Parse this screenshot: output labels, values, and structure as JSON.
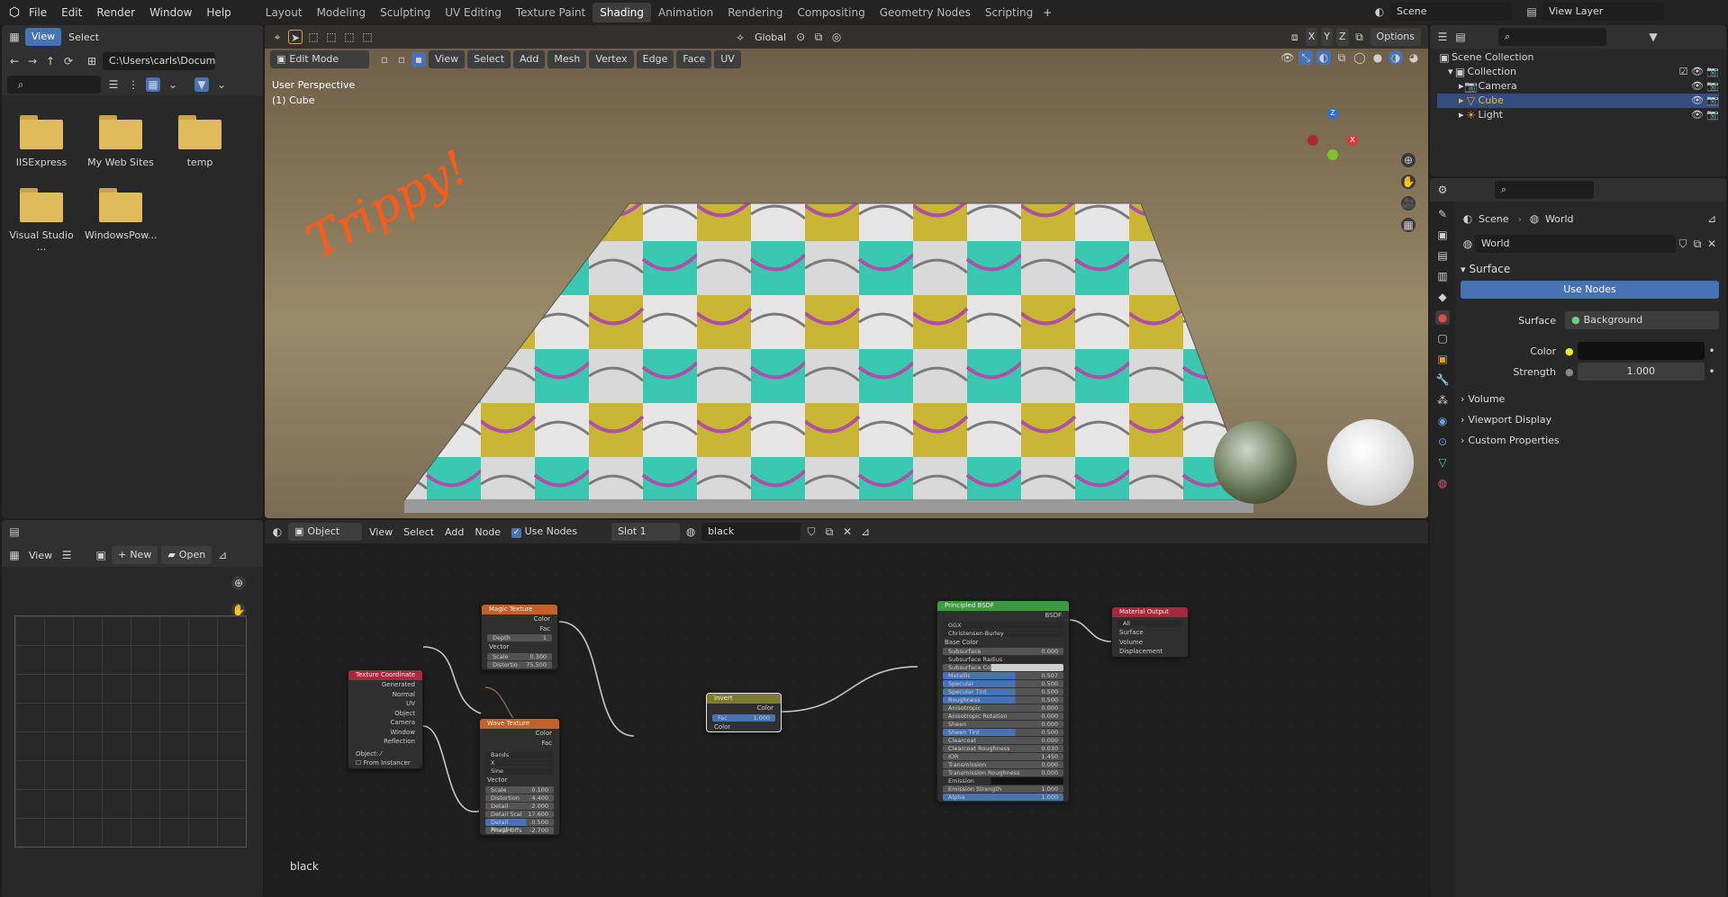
{
  "menu": {
    "file": "File",
    "edit": "Edit",
    "render": "Render",
    "window": "Window",
    "help": "Help"
  },
  "workspaces": [
    "Layout",
    "Modeling",
    "Sculpting",
    "UV Editing",
    "Texture Paint",
    "Shading",
    "Animation",
    "Rendering",
    "Compositing",
    "Geometry Nodes",
    "Scripting"
  ],
  "active_workspace": "Shading",
  "scene": {
    "label": "Scene",
    "view_layer": "View Layer"
  },
  "filebrowser": {
    "view": "View",
    "select": "Select",
    "path": "C:\\Users\\carls\\Docum...",
    "folders": [
      "IISExpress",
      "My Web Sites",
      "temp",
      "Visual Studio ...",
      "WindowsPow..."
    ]
  },
  "viewport": {
    "mode": "Edit Mode",
    "view": "View",
    "select": "Select",
    "add": "Add",
    "mesh": "Mesh",
    "vertex": "Vertex",
    "edge": "Edge",
    "face": "Face",
    "uv": "UV",
    "orientation": "Global",
    "options": "Options",
    "info_line1": "User Perspective",
    "info_line2": "(1) Cube",
    "annotation": "Trippy!",
    "axis_x": "X",
    "axis_y": "Y",
    "axis_z": "Z"
  },
  "image_editor": {
    "view": "View",
    "new": "New",
    "open": "Open"
  },
  "node_editor": {
    "object": "Object",
    "view": "View",
    "select": "Select",
    "add": "Add",
    "node": "Node",
    "use_nodes": "Use Nodes",
    "slot": "Slot 1",
    "material": "black",
    "material_label": "black"
  },
  "nodes": {
    "magic": {
      "title": "Magic Texture",
      "color": "Color",
      "fac": "Fac",
      "depth_label": "Depth",
      "depth": "1",
      "vector": "Vector",
      "scale_label": "Scale",
      "scale": "0.300",
      "distortion_label": "Distortio",
      "distortion": "75.500"
    },
    "texcoord": {
      "title": "Texture Coordinate",
      "outputs": [
        "Generated",
        "Normal",
        "UV",
        "Object",
        "Camera",
        "Window",
        "Reflection"
      ],
      "object_label": "Object:",
      "from_instancer": "From Instancer"
    },
    "wave": {
      "title": "Wave Texture",
      "color": "Color",
      "fac": "Fac",
      "type": "Bands",
      "axis": "X",
      "profile": "Sine",
      "vector": "Vector",
      "fields": [
        [
          "Scale",
          "0.100"
        ],
        [
          "Distortion",
          "4.400"
        ],
        [
          "Detail",
          "2.000"
        ],
        [
          "Detail Scal",
          "17.600"
        ],
        [
          "Detail Roughn",
          "0.500"
        ],
        [
          "Phase Offs",
          "-2.700"
        ]
      ]
    },
    "invert": {
      "title": "Invert",
      "color_out": "Color",
      "fac_label": "Fac",
      "fac": "1.000",
      "color_in": "Color"
    },
    "bsdf": {
      "title": "Principled BSDF",
      "bsdf": "BSDF",
      "dist": "GGX",
      "sss_method": "Christensen-Burley",
      "base_color": "Base Color",
      "fields": [
        [
          "Subsurface",
          "0.000"
        ],
        [
          "Subsurface Radius",
          ""
        ],
        [
          "Subsurface Colo",
          ""
        ],
        [
          "Metallic",
          "0.507"
        ],
        [
          "Specular",
          "0.500"
        ],
        [
          "Specular Tint",
          "0.500"
        ],
        [
          "Roughness",
          "0.500"
        ],
        [
          "Anisotropic",
          "0.000"
        ],
        [
          "Anisotropic Rotation",
          "0.000"
        ],
        [
          "Sheen",
          "0.000"
        ],
        [
          "Sheen Tint",
          "0.500"
        ],
        [
          "Clearcoat",
          "0.000"
        ],
        [
          "Clearcoat Roughness",
          "0.030"
        ],
        [
          "IOR",
          "1.450"
        ],
        [
          "Transmission",
          "0.000"
        ],
        [
          "Transmission Roughness",
          "0.000"
        ],
        [
          "Emission",
          ""
        ],
        [
          "Emission Strength",
          "1.000"
        ],
        [
          "Alpha",
          "1.000"
        ]
      ]
    },
    "output": {
      "title": "Material Output",
      "target": "All",
      "surface": "Surface",
      "volume": "Volume",
      "displacement": "Displacement"
    }
  },
  "outliner": {
    "scene_collection": "Scene Collection",
    "collection": "Collection",
    "items": [
      "Camera",
      "Cube",
      "Light"
    ]
  },
  "properties": {
    "scene": "Scene",
    "world": "World",
    "world_name": "World",
    "surface_section": "Surface",
    "use_nodes": "Use Nodes",
    "surface_label": "Surface",
    "surface_value": "Background",
    "color_label": "Color",
    "strength_label": "Strength",
    "strength_value": "1.000",
    "sections": [
      "Volume",
      "Viewport Display",
      "Custom Properties"
    ]
  },
  "colors": {
    "accent": "#4772b3",
    "annotation": "#ff5a1a",
    "node_texture": "#c0622a",
    "node_input": "#a8283d",
    "node_shader": "#3f9a3f",
    "node_converter": "#7d7a32",
    "node_output": "#a8283d"
  }
}
